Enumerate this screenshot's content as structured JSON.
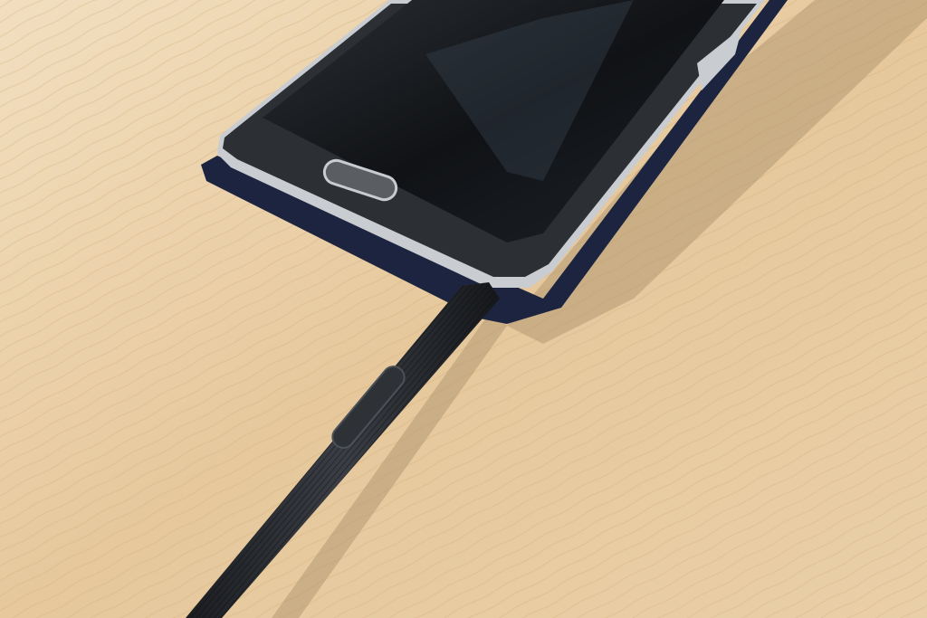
{
  "scene": {
    "subject": "smartphone-with-stylus",
    "colors": {
      "table_light": "#f1dcbb",
      "table_dark": "#d9b98c",
      "phone_body": "#141619",
      "phone_bezel": "#3a3d42",
      "chrome_trim": "#c9ccd0",
      "case": "#1c2440",
      "stylus": "#24272c",
      "shadow": "#a98f6c"
    }
  }
}
